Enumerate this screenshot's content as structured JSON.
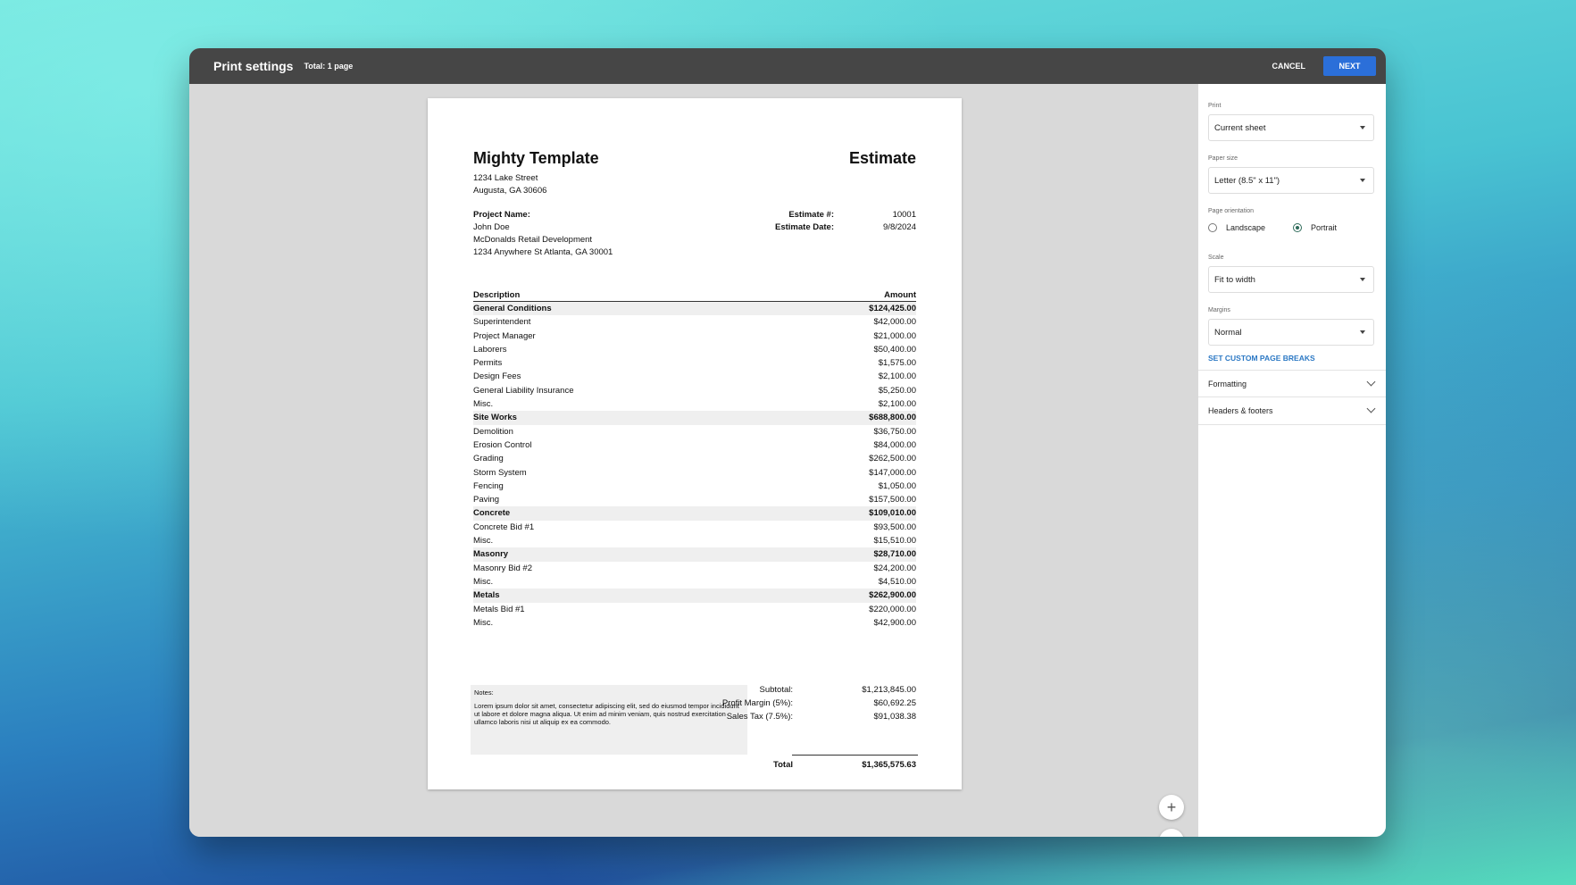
{
  "topbar": {
    "title": "Print settings",
    "subtitle": "Total: 1 page",
    "cancel_label": "CANCEL",
    "next_label": "NEXT"
  },
  "document": {
    "company": "Mighty Template",
    "doc_title": "Estimate",
    "address_line1": "1234 Lake Street",
    "address_line2": "Augusta, GA 30606",
    "project_name_label": "Project Name:",
    "client": "John Doe",
    "project": "McDonalds Retail Development",
    "project_address": "1234 Anywhere St Atlanta, GA 30001",
    "estimate_no_label": "Estimate #:",
    "estimate_no": "10001",
    "estimate_date_label": "Estimate Date:",
    "estimate_date": "9/8/2024",
    "col_description": "Description",
    "col_amount": "Amount",
    "items": [
      {
        "desc": "General Conditions",
        "amount": "$124,425.00",
        "category": true
      },
      {
        "desc": "Superintendent",
        "amount": "$42,000.00"
      },
      {
        "desc": "Project Manager",
        "amount": "$21,000.00"
      },
      {
        "desc": "Laborers",
        "amount": "$50,400.00"
      },
      {
        "desc": "Permits",
        "amount": "$1,575.00"
      },
      {
        "desc": "Design Fees",
        "amount": "$2,100.00"
      },
      {
        "desc": "General Liability Insurance",
        "amount": "$5,250.00"
      },
      {
        "desc": "Misc.",
        "amount": "$2,100.00"
      },
      {
        "desc": "Site Works",
        "amount": "$688,800.00",
        "category": true
      },
      {
        "desc": "Demolition",
        "amount": "$36,750.00"
      },
      {
        "desc": "Erosion Control",
        "amount": "$84,000.00"
      },
      {
        "desc": "Grading",
        "amount": "$262,500.00"
      },
      {
        "desc": "Storm System",
        "amount": "$147,000.00"
      },
      {
        "desc": "Fencing",
        "amount": "$1,050.00"
      },
      {
        "desc": "Paving",
        "amount": "$157,500.00"
      },
      {
        "desc": "Concrete",
        "amount": "$109,010.00",
        "category": true
      },
      {
        "desc": "Concrete Bid #1",
        "amount": "$93,500.00"
      },
      {
        "desc": "Misc.",
        "amount": "$15,510.00"
      },
      {
        "desc": "Masonry",
        "amount": "$28,710.00",
        "category": true
      },
      {
        "desc": "Masonry Bid #2",
        "amount": "$24,200.00"
      },
      {
        "desc": "Misc.",
        "amount": "$4,510.00"
      },
      {
        "desc": "Metals",
        "amount": "$262,900.00",
        "category": true
      },
      {
        "desc": "Metals Bid #1",
        "amount": "$220,000.00"
      },
      {
        "desc": "Misc.",
        "amount": "$42,900.00"
      }
    ],
    "notes_label": "Notes:",
    "notes_text": "Lorem ipsum dolor sit amet, consectetur adipiscing elit, sed do eiusmod tempor incididunt ut labore et dolore magna aliqua. Ut enim ad minim veniam, quis nostrud exercitation ullamco laboris nisi ut aliquip ex ea commodo.",
    "subtotal_label": "Subtotal:",
    "subtotal": "$1,213,845.00",
    "profit_label": "Profit Margin (5%):",
    "profit": "$60,692.25",
    "tax_label": "Sales Tax (7.5%):",
    "tax": "$91,038.38",
    "total_label": "Total",
    "total": "$1,365,575.63"
  },
  "zoom": {
    "in_icon": "+",
    "out_icon": "−"
  },
  "panel": {
    "print_label": "Print",
    "print_value": "Current sheet",
    "paper_label": "Paper size",
    "paper_value": "Letter (8.5\" x 11\")",
    "orientation_label": "Page orientation",
    "landscape_label": "Landscape",
    "portrait_label": "Portrait",
    "orientation_selected": "Portrait",
    "scale_label": "Scale",
    "scale_value": "Fit to width",
    "margins_label": "Margins",
    "margins_value": "Normal",
    "custom_breaks": "SET CUSTOM PAGE BREAKS",
    "formatting": "Formatting",
    "headers_footers": "Headers & footers"
  }
}
